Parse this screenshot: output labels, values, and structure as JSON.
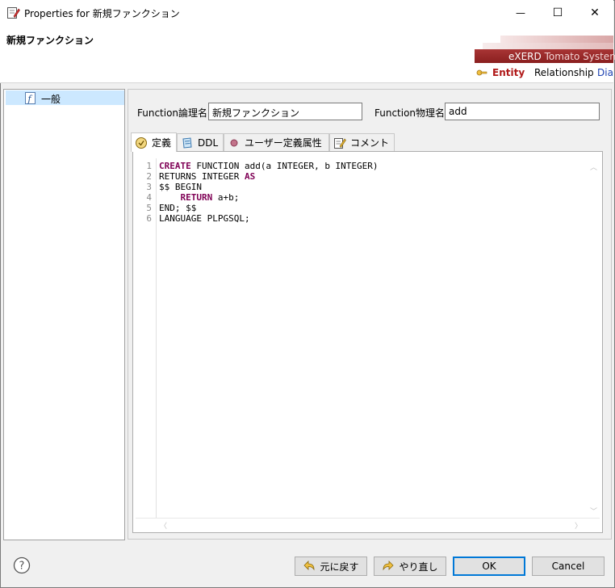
{
  "window": {
    "title": "Properties for 新規ファンクション",
    "minimize_glyph": "—",
    "maximize_glyph": "☐",
    "close_glyph": "✕"
  },
  "header": {
    "title": "新規ファンクション",
    "brand": "eXERD",
    "brand_sub": "Tomato System",
    "tabs": [
      "Entity",
      "Relationship",
      "Diag"
    ]
  },
  "tree": {
    "items": [
      {
        "label": "一般",
        "icon": "function-doc-icon"
      }
    ]
  },
  "fields": {
    "logical_label": "Function論理名",
    "logical_value": "新規ファンクション",
    "physical_label": "Function物理名",
    "physical_value": "add"
  },
  "tabs": [
    {
      "label": "定義",
      "icon": "definition-icon",
      "active": true
    },
    {
      "label": "DDL",
      "icon": "ddl-icon",
      "active": false
    },
    {
      "label": "ユーザー定義属性",
      "icon": "user-attr-icon",
      "active": false
    },
    {
      "label": "コメント",
      "icon": "comment-icon",
      "active": false
    }
  ],
  "editor": {
    "line_numbers": [
      "1",
      "2",
      "3",
      "4",
      "5",
      "6"
    ],
    "lines": [
      [
        {
          "t": "CREATE",
          "kw": true
        },
        {
          "t": " FUNCTION add(a INTEGER, b INTEGER)",
          "kw": false
        }
      ],
      [
        {
          "t": "RETURNS INTEGER ",
          "kw": false
        },
        {
          "t": "AS",
          "kw": true
        }
      ],
      [
        {
          "t": "$$ BEGIN",
          "kw": false
        }
      ],
      [
        {
          "t": "    ",
          "kw": false
        },
        {
          "t": "RETURN",
          "kw": true
        },
        {
          "t": " a+b;",
          "kw": false
        }
      ],
      [
        {
          "t": "END; $$",
          "kw": false
        }
      ],
      [
        {
          "t": "LANGUAGE PLPGSQL;",
          "kw": false
        }
      ]
    ],
    "scroll_up": "︿",
    "scroll_down": "﹀",
    "scroll_left": "〈",
    "scroll_right": "〉"
  },
  "buttons": {
    "help": "?",
    "undo": "元に戻す",
    "redo": "やり直し",
    "ok": "OK",
    "cancel": "Cancel"
  },
  "colors": {
    "keyword": "#7f0055",
    "accent": "#0078d7",
    "brand": "#a83535",
    "tree_selection": "#cce8ff"
  }
}
